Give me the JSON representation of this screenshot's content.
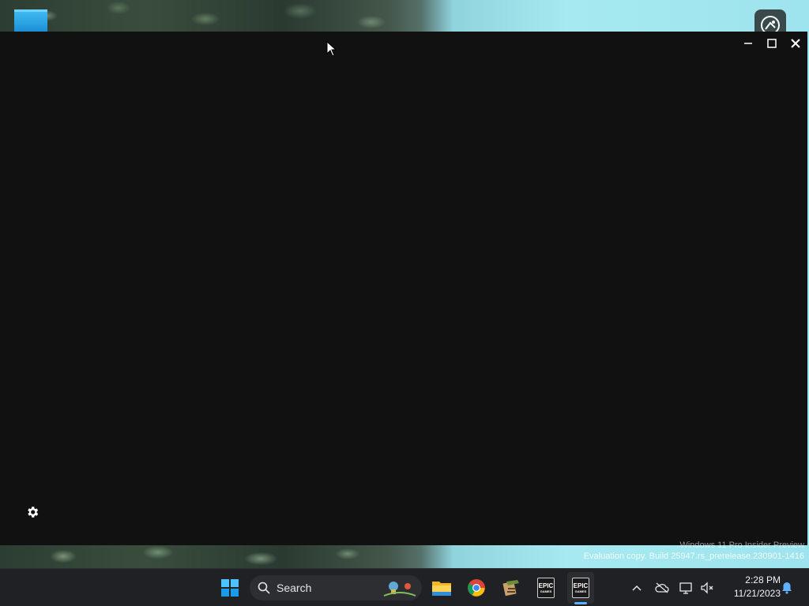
{
  "window": {
    "controls": {
      "minimize": "minimize-icon",
      "maximize": "maximize-icon",
      "close": "close-icon"
    }
  },
  "watermark": {
    "line1": "Windows 11 Pro Insider Preview",
    "line2": "Evaluation copy. Build 25947.rs_prerelease.230901-1416"
  },
  "taskbar": {
    "search": {
      "label": "Search",
      "icon": "search-icon"
    },
    "apps": [
      "start-icon",
      "file-explorer-icon",
      "chrome-icon",
      "app-icon",
      "epic-games-icon",
      "epic-games-icon"
    ],
    "epic_label": "EPIC",
    "epic_sublabel": "GAMES",
    "clock": {
      "time": "2:28 PM",
      "date": "11/21/2023"
    }
  },
  "colors": {
    "window_bg": "#111111",
    "taskbar_bg": "#1f2124",
    "accent": "#5fb2ff"
  }
}
